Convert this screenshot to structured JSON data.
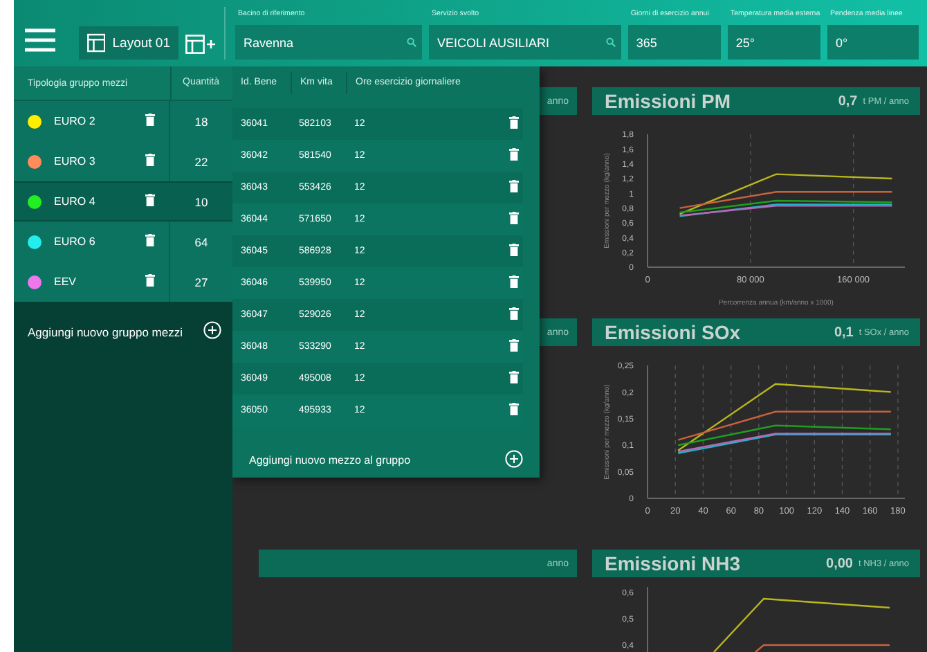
{
  "toolbar": {
    "layout_button": "Layout 01",
    "fields": [
      {
        "label": "Bacino di riferimento",
        "value": "Ravenna",
        "kind": "search"
      },
      {
        "label": "Servizio svolto",
        "value": "VEICOLI AUSILIARI",
        "kind": "search"
      },
      {
        "label": "Giorni di esercizio annui",
        "value": "365",
        "kind": "plain"
      },
      {
        "label": "Temperatura media esterna",
        "value": "25°",
        "kind": "plain"
      },
      {
        "label": "Pendenza media linee",
        "value": "0°",
        "kind": "plain"
      }
    ]
  },
  "groups": {
    "columns": [
      "Tipologia gruppo mezzi",
      "Quantità"
    ],
    "rows": [
      {
        "name": "EURO 2",
        "color": "#ffee00",
        "quantity": "18",
        "selected": false
      },
      {
        "name": "EURO 3",
        "color": "#ff8c5a",
        "quantity": "22",
        "selected": false
      },
      {
        "name": "EURO 4",
        "color": "#22ee22",
        "quantity": "10",
        "selected": true
      },
      {
        "name": "EURO 6",
        "color": "#22eeee",
        "quantity": "64",
        "selected": false
      },
      {
        "name": "EEV",
        "color": "#ee77ee",
        "quantity": "27",
        "selected": false
      }
    ],
    "add_label": "Aggiungi nuovo gruppo mezzi"
  },
  "vehicles": {
    "columns": [
      "Id. Bene",
      "Km vita",
      "Ore esercizio giornaliere"
    ],
    "rows": [
      {
        "id": "36041",
        "km": "582103",
        "hours": "12"
      },
      {
        "id": "36042",
        "km": "581540",
        "hours": "12"
      },
      {
        "id": "36043",
        "km": "553426",
        "hours": "12"
      },
      {
        "id": "36044",
        "km": "571650",
        "hours": "12"
      },
      {
        "id": "36045",
        "km": "586928",
        "hours": "12"
      },
      {
        "id": "36046",
        "km": "539950",
        "hours": "12"
      },
      {
        "id": "36047",
        "km": "529026",
        "hours": "12"
      },
      {
        "id": "36048",
        "km": "533290",
        "hours": "12"
      },
      {
        "id": "36049",
        "km": "495008",
        "hours": "12"
      },
      {
        "id": "36050",
        "km": "495933",
        "hours": "12"
      }
    ],
    "add_label": "Aggiungi nuovo mezzo al gruppo"
  },
  "hidden_cards": [
    {
      "unit": "anno"
    },
    {
      "unit": "anno"
    },
    {
      "unit": "anno"
    }
  ],
  "charts": [
    {
      "title": "Emissioni PM",
      "value": "0,7",
      "unit": "t PM / anno",
      "chart_data": {
        "type": "line",
        "grid": true,
        "xlabel": "Percorrenza annua (km/anno x 1000)",
        "ylabel": "Emissioni per mezzo (kg/anno)",
        "x": [
          25000,
          100000,
          190000
        ],
        "xlim": [
          0,
          200000
        ],
        "ylim": [
          0,
          1.8
        ],
        "xticks": [
          {
            "value": 0,
            "label": "0"
          },
          {
            "value": 80000,
            "label": "80 000"
          },
          {
            "value": 160000,
            "label": "160 000"
          }
        ],
        "yticks": [
          {
            "value": 0,
            "label": "0"
          },
          {
            "value": 0.2,
            "label": "0,2"
          },
          {
            "value": 0.4,
            "label": "0,4"
          },
          {
            "value": 0.6,
            "label": "0,6"
          },
          {
            "value": 0.8,
            "label": "0,8"
          },
          {
            "value": 1,
            "label": "1"
          },
          {
            "value": 1.2,
            "label": "1,2"
          },
          {
            "value": 1.4,
            "label": "1,4"
          },
          {
            "value": 1.6,
            "label": "1,6"
          },
          {
            "value": 1.8,
            "label": "1,8"
          }
        ],
        "series": [
          {
            "color": "#b8b81c",
            "values": [
              0.72,
              1.26,
              1.2
            ]
          },
          {
            "color": "#c8623e",
            "values": [
              0.8,
              1.02,
              1.02
            ]
          },
          {
            "color": "#1ea01e",
            "values": [
              0.74,
              0.9,
              0.88
            ]
          },
          {
            "color": "#22b4c4",
            "values": [
              0.69,
              0.85,
              0.85
            ]
          },
          {
            "color": "#b866b8",
            "values": [
              0.7,
              0.83,
              0.83
            ]
          }
        ]
      }
    },
    {
      "title": "Emissioni SOx",
      "value": "0,1",
      "unit": "t SOx / anno",
      "chart_data": {
        "type": "line",
        "grid": true,
        "ylabel": "Emissioni per mezzo (kg/anno)",
        "x": [
          22,
          92,
          175
        ],
        "xlim": [
          0,
          185
        ],
        "ylim": [
          0,
          0.25
        ],
        "xticks": [
          0,
          20,
          40,
          60,
          80,
          100,
          120,
          140,
          160,
          180
        ],
        "yticks": [
          {
            "value": 0,
            "label": "0"
          },
          {
            "value": 0.05,
            "label": "0,05"
          },
          {
            "value": 0.1,
            "label": "0,1"
          },
          {
            "value": 0.15,
            "label": "0,15"
          },
          {
            "value": 0.2,
            "label": "0,2"
          },
          {
            "value": 0.25,
            "label": "0,25"
          }
        ],
        "series": [
          {
            "color": "#b8b81c",
            "values": [
              0.09,
              0.215,
              0.2
            ]
          },
          {
            "color": "#c8623e",
            "values": [
              0.11,
              0.163,
              0.163
            ]
          },
          {
            "color": "#1ea01e",
            "values": [
              0.1,
              0.137,
              0.13
            ]
          },
          {
            "color": "#22b4c4",
            "values": [
              0.085,
              0.12,
              0.12
            ]
          },
          {
            "color": "#b866b8",
            "values": [
              0.088,
              0.122,
              0.122
            ]
          }
        ]
      }
    },
    {
      "title": "Emissioni NH3",
      "value": "0,00",
      "unit": "t NH3 / anno",
      "tick_labels": [
        "0,6",
        "0,5",
        "0,4"
      ]
    }
  ]
}
